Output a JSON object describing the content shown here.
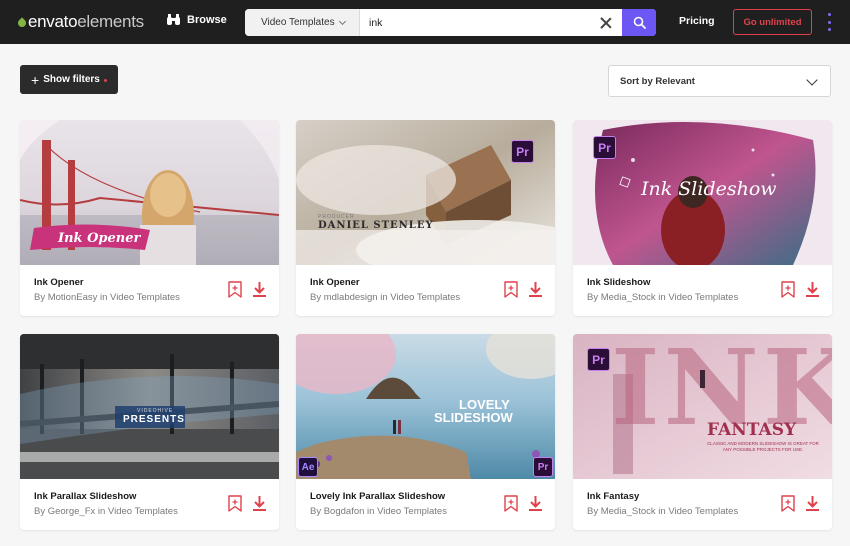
{
  "header": {
    "logo_primary": "envato",
    "logo_secondary": "elements",
    "browse_label": "Browse",
    "category_label": "Video Templates",
    "search_value": "ink",
    "pricing_label": "Pricing",
    "cta_label": "Go unlimited",
    "accent_color": "#6c57f5",
    "cta_color": "#e0424d"
  },
  "filters": {
    "show_filters_label": "Show filters",
    "sort_label": "Sort by Relevant"
  },
  "cards": [
    {
      "title": "Ink Opener",
      "meta": "By MotionEasy in Video Templates",
      "overlay": "Ink Opener",
      "badge": ""
    },
    {
      "title": "Ink Opener",
      "meta": "By mdlabdesign in Video Templates",
      "overlay_small": "PRODUCER",
      "overlay": "DANIEL STENLEY",
      "badge": "Pr"
    },
    {
      "title": "Ink Slideshow",
      "meta": "By Media_Stock in Video Templates",
      "overlay": "Ink Slideshow",
      "badge": "Pr"
    },
    {
      "title": "Ink Parallax Slideshow",
      "meta": "By George_Fx in Video Templates",
      "overlay_small": "VIDEOHIVE",
      "overlay": "PRESENTS",
      "badge": ""
    },
    {
      "title": "Lovely Ink Parallax Slideshow",
      "meta": "By Bogdafon in Video Templates",
      "overlay": "LOVELY",
      "overlay2": "SLIDESHOW",
      "badge": "Pr",
      "badge2": "Ae"
    },
    {
      "title": "Ink Fantasy",
      "meta": "By Media_Stock in Video Templates",
      "overlay_big": "INK",
      "overlay": "FANTASY",
      "overlay_small": "CLASSIC AND MODERN SLIDESHOW IS GREAT FOR ANY POSSIBLE PROJECTS FOR USE.",
      "badge": "Pr"
    }
  ]
}
